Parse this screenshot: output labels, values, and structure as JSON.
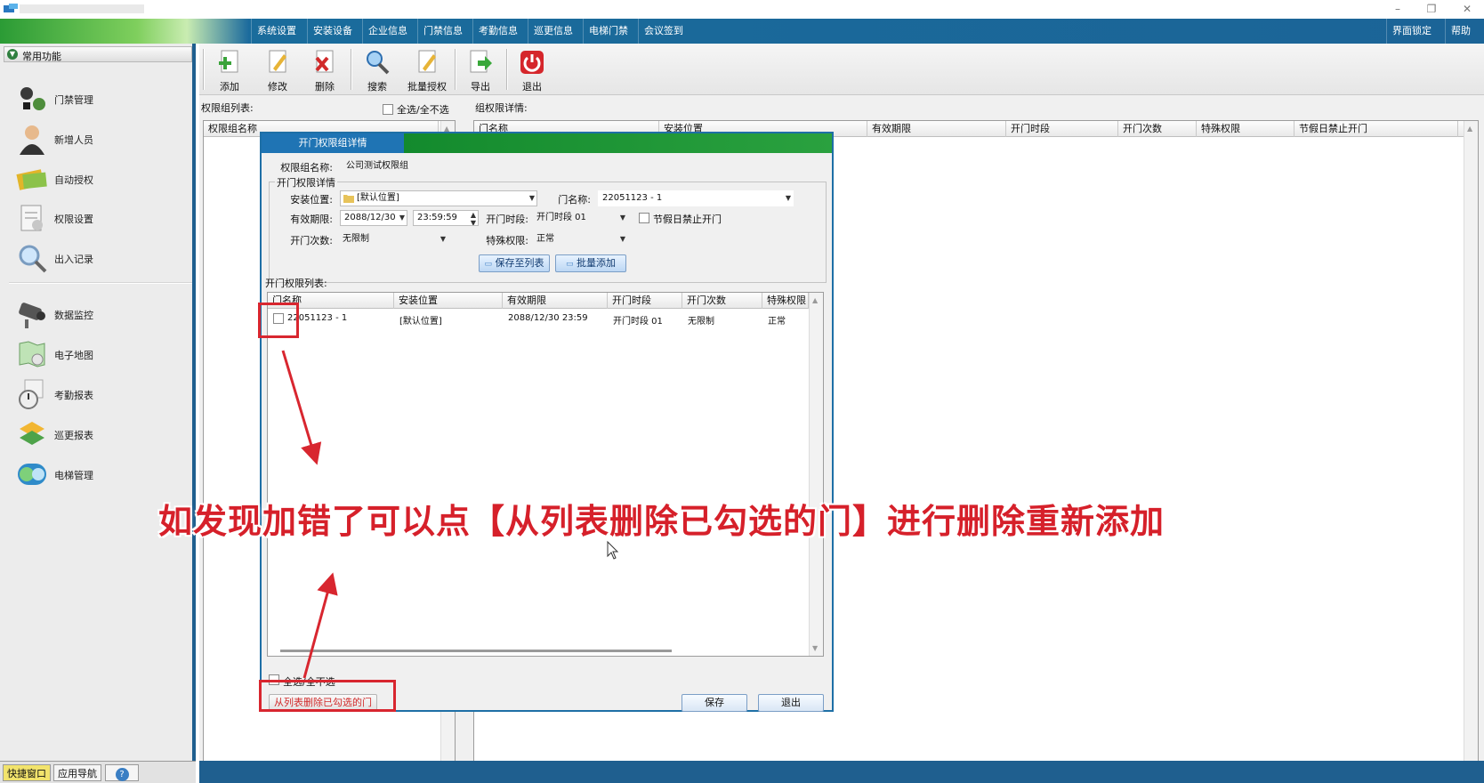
{
  "menubar": {
    "items": [
      "系统设置",
      "安装设备",
      "企业信息",
      "门禁信息",
      "考勤信息",
      "巡更信息",
      "电梯门禁",
      "会议签到"
    ],
    "right_items": [
      "界面锁定",
      "帮助"
    ]
  },
  "leftpanel": {
    "header": "常用功能",
    "items": [
      "门禁管理",
      "新增人员",
      "自动授权",
      "权限设置",
      "出入记录",
      "数据监控",
      "电子地图",
      "考勤报表",
      "巡更报表",
      "电梯管理"
    ]
  },
  "bottomtabs": {
    "quick": "快捷窗口",
    "nav": "应用导航"
  },
  "toolbar": {
    "add": "添加",
    "edit": "修改",
    "delete": "删除",
    "search": "搜索",
    "batch_auth": "批量授权",
    "export": "导出",
    "exit": "退出"
  },
  "left_list": {
    "label": "权限组列表:",
    "select_all": "全选/全不选",
    "columns": [
      "权限组名称"
    ]
  },
  "right_list": {
    "label": "组权限详情:",
    "columns": [
      "门名称",
      "安装位置",
      "有效期限",
      "开门时段",
      "开门次数",
      "特殊权限",
      "节假日禁止开门"
    ]
  },
  "dialog": {
    "title": "开门权限组详情",
    "group_name_label": "权限组名称:",
    "group_name_value": "公司测试权限组",
    "detail_group_label": "开门权限详情",
    "install_label": "安装位置:",
    "install_value": "[默认位置]",
    "door_name_label": "门名称:",
    "door_name_value": "22051123 - 1",
    "valid_label": "有效期限:",
    "valid_date": "2088/12/30",
    "valid_time": "23:59:59",
    "period_label": "开门时段:",
    "period_value": "开门时段 01",
    "holiday_label": "节假日禁止开门",
    "count_label": "开门次数:",
    "count_value": "无限制",
    "special_label": "特殊权限:",
    "special_value": "正常",
    "save_to_list": "保存至列表",
    "batch_add": "批量添加",
    "list_label": "开门权限列表:",
    "list_columns": [
      "门名称",
      "安装位置",
      "有效期限",
      "开门时段",
      "开门次数",
      "特殊权限"
    ],
    "rows": [
      {
        "door": "22051123 - 1",
        "location": "[默认位置]",
        "valid": "2088/12/30 23:59",
        "period": "开门时段 01",
        "count": "无限制",
        "special": "正常"
      }
    ],
    "select_all": "全选/全不选",
    "remove_checked": "从列表删除已勾选的门",
    "save": "保存",
    "exit": "退出"
  },
  "overlay": {
    "caption": "如发现加错了可以点【从列表删除已勾选的门】进行删除重新添加"
  },
  "colors": {
    "annotation_red": "#d8262f",
    "frame_blue": "#1f5f8f",
    "menu_green": "#2f8f2a"
  }
}
